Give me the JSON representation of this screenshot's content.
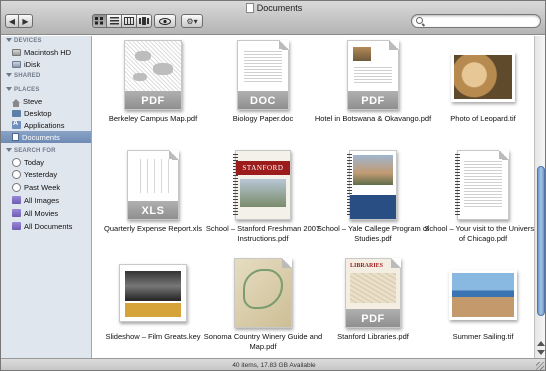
{
  "window": {
    "title": "Documents"
  },
  "toolbar": {
    "back_icon": "back-arrow-icon",
    "forward_icon": "forward-arrow-icon",
    "view_modes": [
      "icon-view",
      "list-view",
      "column-view",
      "coverflow-view"
    ],
    "active_view": "icon-view",
    "quicklook_icon": "eye-icon",
    "action_icon": "gear-icon",
    "search_value": ""
  },
  "sidebar": {
    "sections": [
      {
        "label": "DEVICES",
        "items": [
          {
            "label": "Macintosh HD",
            "icon": "hard-drive-icon"
          },
          {
            "label": "iDisk",
            "icon": "idisk-icon"
          }
        ]
      },
      {
        "label": "SHARED",
        "items": []
      },
      {
        "label": "PLACES",
        "items": [
          {
            "label": "Steve",
            "icon": "home-icon"
          },
          {
            "label": "Desktop",
            "icon": "desktop-folder-icon"
          },
          {
            "label": "Applications",
            "icon": "applications-folder-icon"
          },
          {
            "label": "Documents",
            "icon": "documents-folder-icon",
            "selected": true
          }
        ]
      },
      {
        "label": "SEARCH FOR",
        "items": [
          {
            "label": "Today",
            "icon": "clock-icon"
          },
          {
            "label": "Yesterday",
            "icon": "clock-icon"
          },
          {
            "label": "Past Week",
            "icon": "clock-icon"
          },
          {
            "label": "All Images",
            "icon": "smart-folder-icon"
          },
          {
            "label": "All Movies",
            "icon": "smart-folder-icon"
          },
          {
            "label": "All Documents",
            "icon": "smart-folder-icon"
          }
        ]
      }
    ]
  },
  "files": [
    {
      "name": "Berkeley Campus Map.pdf",
      "badge": "PDF"
    },
    {
      "name": "Biology Paper.doc",
      "badge": "DOC"
    },
    {
      "name": "Hotel in Botswana & Okavango.pdf",
      "badge": "PDF"
    },
    {
      "name": "Photo of Leopard.tif",
      "badge": ""
    },
    {
      "name": "Quarterly Expense Report.xls",
      "badge": "XLS"
    },
    {
      "name": "School – Stanford Freshman 2007 Instructions.pdf",
      "badge": "STANFORD"
    },
    {
      "name": "School – Yale Callege Program of Studies.pdf",
      "badge": ""
    },
    {
      "name": "School – Your visit to the University of Chicago.pdf",
      "badge": ""
    },
    {
      "name": "Slideshow – Film Greats.key",
      "badge": ""
    },
    {
      "name": "Sonoma Country Winery Guide and Map.pdf",
      "badge": ""
    },
    {
      "name": "Stanford Libraries.pdf",
      "badge": "PDF",
      "header": "LIBRARIES"
    },
    {
      "name": "Summer Sailing.tif",
      "badge": ""
    }
  ],
  "status": {
    "text": "40 items, 17.83 GB Available"
  },
  "colors": {
    "selection": "#6f8bb5",
    "sidebar_bg": "#e0e6ee",
    "scroll_thumb": "#6f98c9",
    "stanford_red": "#9c1b1b"
  }
}
